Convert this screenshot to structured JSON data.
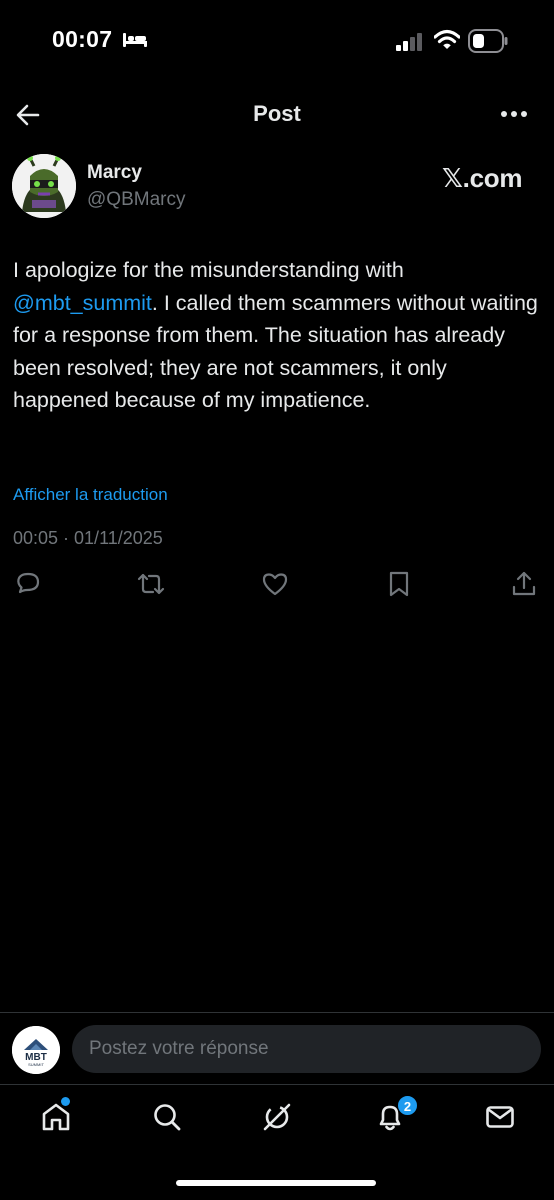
{
  "status_bar": {
    "time": "00:07"
  },
  "header": {
    "title": "Post"
  },
  "post": {
    "author": {
      "name": "Marcy",
      "handle": "@QBMarcy"
    },
    "watermark": "𝕏.com",
    "text_before_mention": "I apologize for the misunderstanding with ",
    "mention": "@mbt_summit",
    "text_after_mention": ". I called them scammers without waiting for a response from them. The situation has already been resolved; they are not scammers, it only happened because of my impatience.",
    "translate_link": "Afficher la traduction",
    "timestamp": "00:05 · 01/11/2025"
  },
  "reply_bar": {
    "placeholder": "Postez votre réponse",
    "avatar_logo_text": "MBT",
    "avatar_logo_subtext": "SUMMIT"
  },
  "tab_bar": {
    "notification_count": "2"
  },
  "colors": {
    "background": "#000000",
    "text_primary": "#e7e9ea",
    "text_secondary": "#71767b",
    "accent": "#1d9bf0",
    "input_bg": "#202327"
  },
  "icons": {
    "status": [
      "sleep-icon",
      "signal-icon",
      "wifi-icon",
      "battery-icon"
    ],
    "header": [
      "back-arrow-icon",
      "more-options-icon"
    ],
    "actions": [
      "reply-icon",
      "repost-icon",
      "like-icon",
      "bookmark-icon",
      "share-icon"
    ],
    "tabs": [
      "home-icon",
      "search-icon",
      "grok-icon",
      "notifications-icon",
      "messages-icon"
    ]
  }
}
